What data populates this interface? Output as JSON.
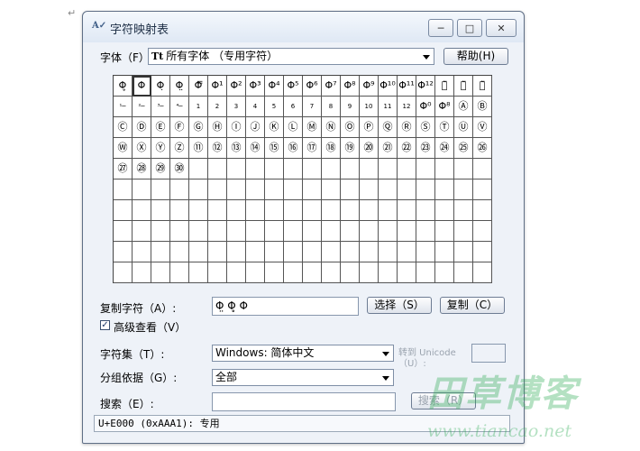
{
  "page": {
    "paragraph_mark": "↵"
  },
  "window": {
    "title": "字符映射表",
    "app_icon": "charmap-icon",
    "controls": {
      "minimize": "─",
      "maximize": "□",
      "close": "✕"
    }
  },
  "font_row": {
    "label": "字体（F）:",
    "tt_glyph": "Tt",
    "value": "所有字体 （专用字符）",
    "help_button": "帮助(H)"
  },
  "char_grid": {
    "selected_index": 1,
    "cells": [
      "Φ̥",
      "Φ",
      "Φ̣",
      "Φ̤",
      "Φ̿",
      "Φ¹",
      "Φ²",
      "Φ³",
      "Φ⁴",
      "Φ⁵",
      "Φ⁶",
      "Φ⁷",
      "Φ⁸",
      "Φ⁹",
      "Φ¹⁰",
      "Φ¹¹",
      "Φ¹²",
      "Ⓐ̃",
      "Ⓑ̃",
      "Ⓒ̃",
      "¹─",
      "²─",
      "³─",
      "⁴─",
      "1",
      "2",
      "3",
      "4",
      "5",
      "6",
      "7",
      "8",
      "9",
      "10",
      "11",
      "12",
      "Φ⁰",
      "Φ⁸",
      "Ⓐ",
      "Ⓑ",
      "Ⓒ",
      "Ⓓ",
      "Ⓔ",
      "Ⓕ",
      "Ⓖ",
      "Ⓗ",
      "Ⓘ",
      "Ⓙ",
      "Ⓚ",
      "Ⓛ",
      "Ⓜ",
      "Ⓝ",
      "Ⓞ",
      "Ⓟ",
      "Ⓠ",
      "Ⓡ",
      "Ⓢ",
      "Ⓣ",
      "Ⓤ",
      "Ⓥ",
      "Ⓦ",
      "Ⓧ",
      "Ⓨ",
      "Ⓩ",
      "⑪",
      "⑫",
      "⑬",
      "⑭",
      "⑮",
      "⑯",
      "⑰",
      "⑱",
      "⑲",
      "⑳",
      "㉑",
      "㉒",
      "㉓",
      "㉔",
      "㉕",
      "㉖",
      "㉗",
      "㉘",
      "㉙",
      "㉚"
    ]
  },
  "copy_row": {
    "label": "复制字符（A）:",
    "value": "Φ̤ Φ̥ Φ",
    "select_button": "选择（S）",
    "copy_button": "复制（C）"
  },
  "advanced": {
    "label": "高级查看（V）",
    "checked": "✓"
  },
  "charset_row": {
    "label": "字符集（T）:",
    "value": "Windows: 简体中文",
    "goto_label": "转到 Unicode（U）:"
  },
  "group_row": {
    "label": "分组依据（G）:",
    "value": "全部"
  },
  "search_row": {
    "label": "搜索（E）:",
    "value": "",
    "search_button": "搜索（R）"
  },
  "status": {
    "text": "U+E000 (0xAAA1): 专用"
  },
  "watermark": {
    "text": "田草博客",
    "url": "www.tiancao.net"
  }
}
